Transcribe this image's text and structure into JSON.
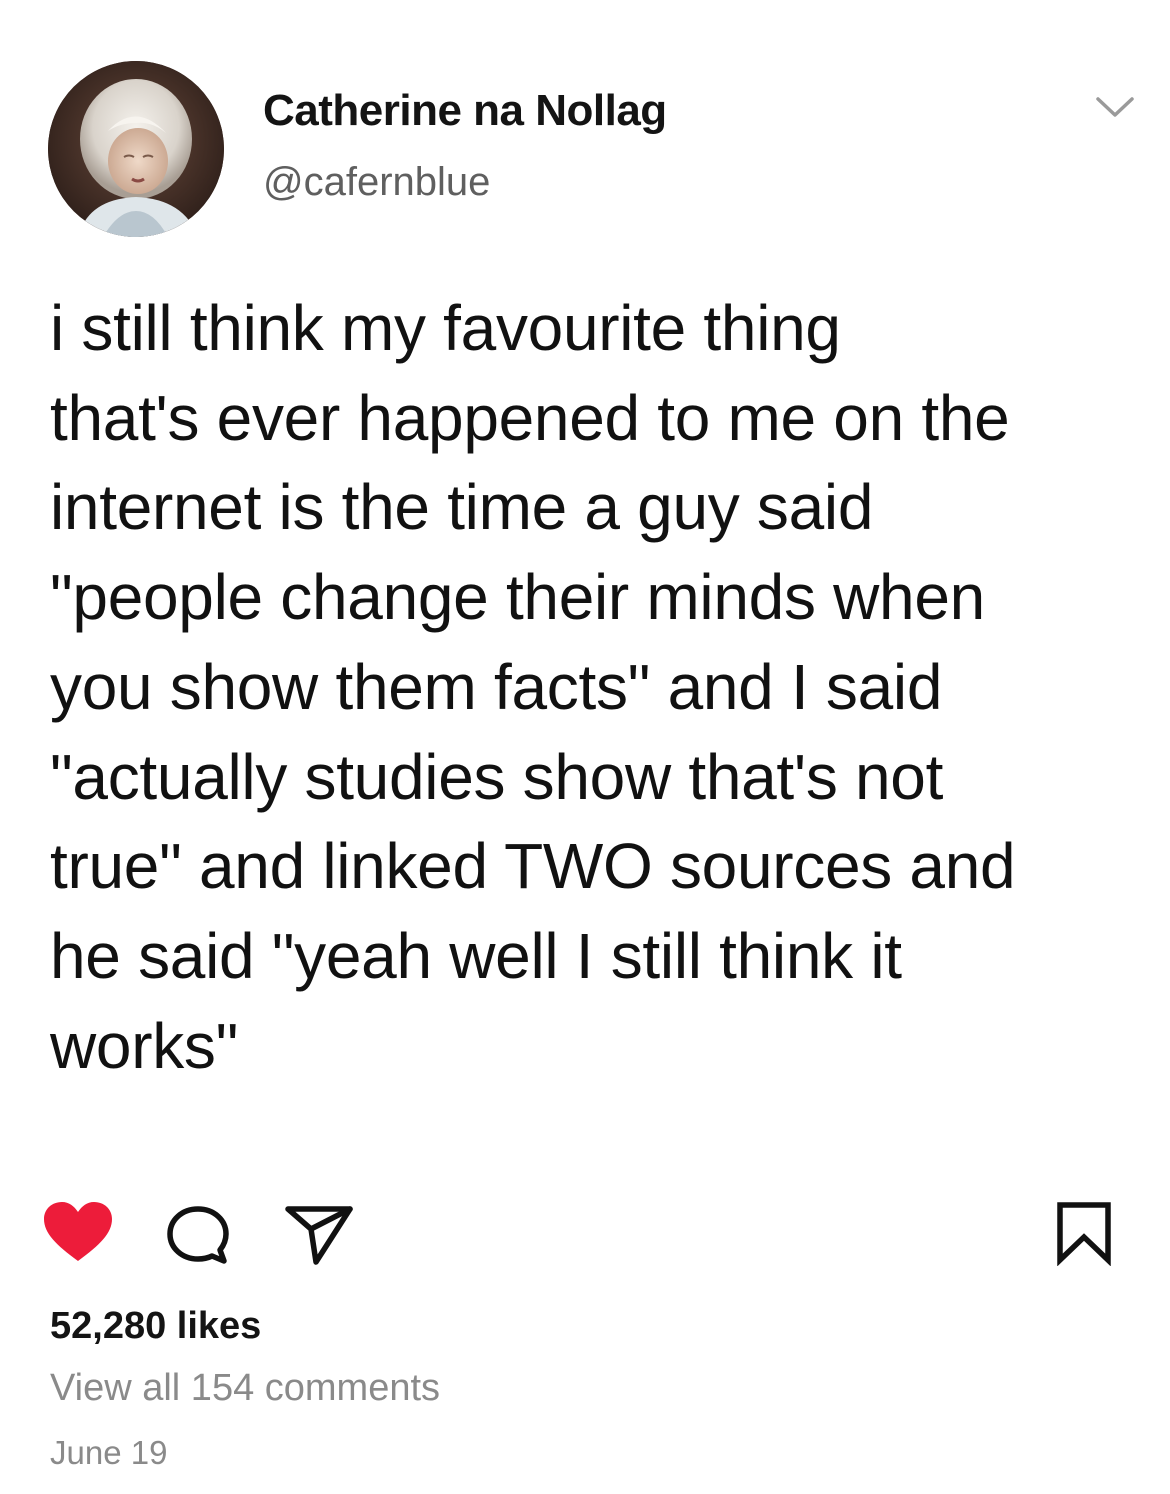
{
  "post": {
    "author": {
      "display_name": "Catherine na Nollag",
      "handle": "@cafernblue",
      "avatar_icon": "profile-photo"
    },
    "menu_icon": "chevron-down-icon",
    "text": "i still think my favourite thing\nthat's ever happened to me on the\ninternet is the time a guy said\n\"people change their minds when\nyou show them facts\" and I said\n\"actually studies show that's not\ntrue\" and linked TWO sources and\nhe said \"yeah well I still think it\nworks\"",
    "actions": {
      "like_icon": "heart-icon",
      "comment_icon": "comment-bubble-icon",
      "share_icon": "send-paper-plane-icon",
      "save_icon": "bookmark-icon",
      "like_color": "#ed1c3a",
      "liked": true
    },
    "likes_label": "52,280 likes",
    "comments_link": "View all 154 comments",
    "date": "June 19"
  }
}
